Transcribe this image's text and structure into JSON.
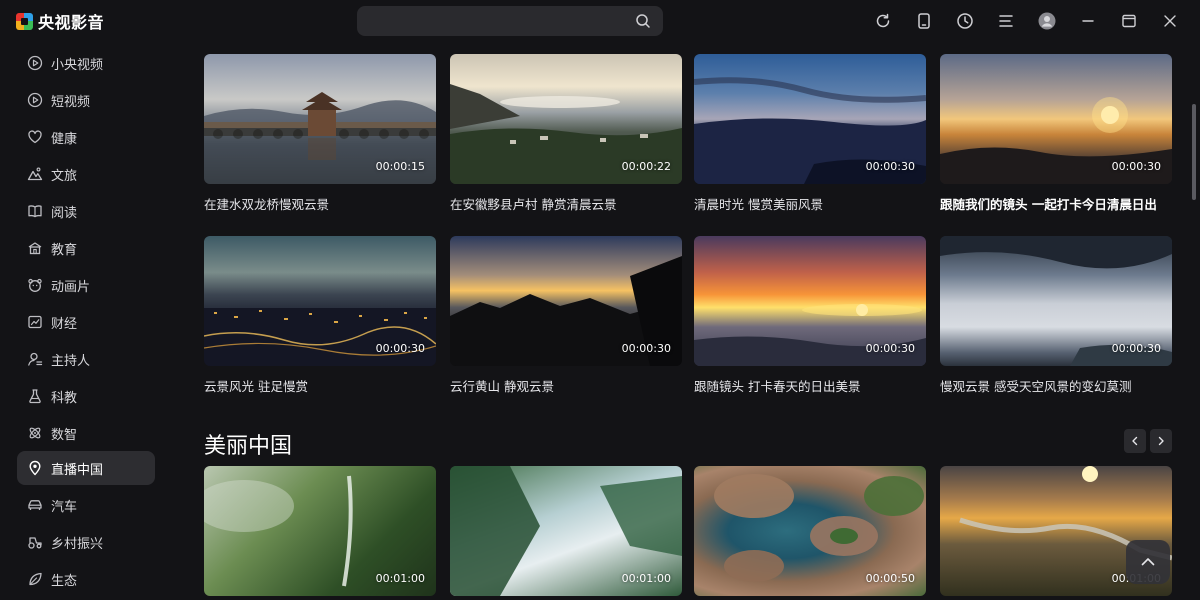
{
  "app": {
    "title": "央视影音"
  },
  "search": {
    "placeholder": ""
  },
  "top_actions": [
    {
      "name": "refresh-button",
      "icon": "refresh-icon"
    },
    {
      "name": "mobile-button",
      "icon": "mobile-icon"
    },
    {
      "name": "history-button",
      "icon": "history-icon"
    },
    {
      "name": "menu-button",
      "icon": "menu-icon"
    },
    {
      "name": "user-button",
      "icon": "user-avatar-icon"
    },
    {
      "name": "minimize-button",
      "icon": "minimize-icon"
    },
    {
      "name": "maximize-button",
      "icon": "maximize-icon"
    },
    {
      "name": "close-button",
      "icon": "close-icon"
    }
  ],
  "sidebar": {
    "items": [
      {
        "label": "小央视频",
        "icon": "play-circle-icon"
      },
      {
        "label": "短视频",
        "icon": "play-circle-icon"
      },
      {
        "label": "健康",
        "icon": "heart-icon"
      },
      {
        "label": "文旅",
        "icon": "mountain-icon"
      },
      {
        "label": "阅读",
        "icon": "book-icon"
      },
      {
        "label": "教育",
        "icon": "school-icon"
      },
      {
        "label": "动画片",
        "icon": "bear-icon"
      },
      {
        "label": "财经",
        "icon": "chart-icon"
      },
      {
        "label": "主持人",
        "icon": "host-icon"
      },
      {
        "label": "科教",
        "icon": "flask-icon"
      },
      {
        "label": "数智",
        "icon": "atom-icon"
      },
      {
        "label": "直播中国",
        "icon": "location-pin-icon",
        "active": true
      },
      {
        "label": "汽车",
        "icon": "car-icon"
      },
      {
        "label": "乡村振兴",
        "icon": "tractor-icon"
      },
      {
        "label": "生态",
        "icon": "leaf-icon"
      }
    ]
  },
  "videos": [
    {
      "title": "在建水双龙桥慢观云景",
      "duration": "00:00:15"
    },
    {
      "title": "在安徽黟县卢村 静赏清晨云景",
      "duration": "00:00:22"
    },
    {
      "title": "清晨时光 慢赏美丽风景",
      "duration": "00:00:30"
    },
    {
      "title": "跟随我们的镜头 一起打卡今日清晨日出",
      "duration": "00:00:30"
    },
    {
      "title": "云景风光 驻足慢赏",
      "duration": "00:00:30"
    },
    {
      "title": "云行黄山 静观云景",
      "duration": "00:00:30"
    },
    {
      "title": "跟随镜头 打卡春天的日出美景",
      "duration": "00:00:30"
    },
    {
      "title": "慢观云景 感受天空风景的变幻莫测",
      "duration": "00:00:30"
    }
  ],
  "section": {
    "title": "美丽中国",
    "videos": [
      {
        "duration": "00:01:00"
      },
      {
        "duration": "00:01:00"
      },
      {
        "duration": "00:00:50"
      },
      {
        "duration": "00:01:00"
      }
    ]
  }
}
